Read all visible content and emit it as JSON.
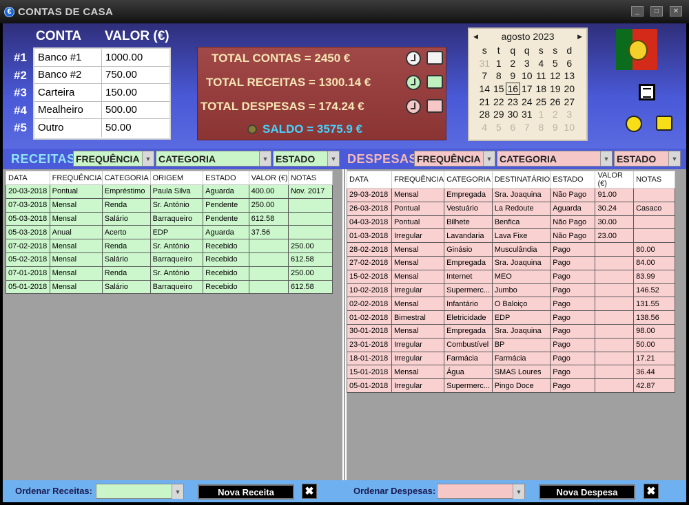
{
  "window": {
    "title": "CONTAS DE CASA",
    "app_icon": "€",
    "min": "_",
    "max": "□",
    "close": "✕"
  },
  "accounts": {
    "header_conta": "CONTA",
    "header_valor": "VALOR (€)",
    "rows": [
      {
        "num": "#1",
        "name": "Banco #1",
        "value": "1000.00"
      },
      {
        "num": "#2",
        "name": "Banco #2",
        "value": "750.00"
      },
      {
        "num": "#3",
        "name": "Carteira",
        "value": "150.00"
      },
      {
        "num": "#4",
        "name": "Mealheiro",
        "value": "500.00"
      },
      {
        "num": "#5",
        "name": "Outro",
        "value": "50.00"
      }
    ]
  },
  "totals": {
    "contas": "TOTAL CONTAS = 2450 €",
    "receitas": "TOTAL RECEITAS = 1300.14 €",
    "despesas": "TOTAL DESPESAS = 174.24 €",
    "saldo": "SALDO = 3575.9 €"
  },
  "calendar": {
    "month": "agosto 2023",
    "prev": "◀",
    "next": "▶",
    "weekdays": [
      "s",
      "t",
      "q",
      "q",
      "s",
      "s",
      "d"
    ],
    "days": [
      {
        "d": "31",
        "o": true
      },
      {
        "d": "1"
      },
      {
        "d": "2"
      },
      {
        "d": "3"
      },
      {
        "d": "4"
      },
      {
        "d": "5"
      },
      {
        "d": "6"
      },
      {
        "d": "7"
      },
      {
        "d": "8"
      },
      {
        "d": "9"
      },
      {
        "d": "10"
      },
      {
        "d": "11"
      },
      {
        "d": "12"
      },
      {
        "d": "13"
      },
      {
        "d": "14"
      },
      {
        "d": "15"
      },
      {
        "d": "16",
        "t": true
      },
      {
        "d": "17"
      },
      {
        "d": "18"
      },
      {
        "d": "19"
      },
      {
        "d": "20"
      },
      {
        "d": "21"
      },
      {
        "d": "22"
      },
      {
        "d": "23"
      },
      {
        "d": "24"
      },
      {
        "d": "25"
      },
      {
        "d": "26"
      },
      {
        "d": "27"
      },
      {
        "d": "28"
      },
      {
        "d": "29"
      },
      {
        "d": "30"
      },
      {
        "d": "31"
      },
      {
        "d": "1",
        "o": true
      },
      {
        "d": "2",
        "o": true
      },
      {
        "d": "3",
        "o": true
      },
      {
        "d": "4",
        "o": true
      },
      {
        "d": "5",
        "o": true
      },
      {
        "d": "6",
        "o": true
      },
      {
        "d": "7",
        "o": true
      },
      {
        "d": "8",
        "o": true
      },
      {
        "d": "9",
        "o": true
      },
      {
        "d": "10",
        "o": true
      }
    ]
  },
  "receitas": {
    "title": "RECEITAS",
    "filters": {
      "frequencia": "FREQUÊNCIA",
      "categoria": "CATEGORIA",
      "estado": "ESTADO"
    },
    "columns": [
      "DATA",
      "FREQUÊNCIA",
      "CATEGORIA",
      "ORIGEM",
      "ESTADO",
      "VALOR (€)",
      "NOTAS"
    ],
    "rows": [
      [
        "20-03-2018",
        "Pontual",
        "Empréstimo",
        "Paula Silva",
        "Aguarda",
        "400.00",
        "Nov. 2017"
      ],
      [
        "07-03-2018",
        "Mensal",
        "Renda",
        "Sr. António",
        "Pendente",
        "250.00",
        ""
      ],
      [
        "05-03-2018",
        "Mensal",
        "Salário",
        "Barraqueiro",
        "Pendente",
        "612.58",
        ""
      ],
      [
        "05-03-2018",
        "Anual",
        "Acerto",
        "EDP",
        "Aguarda",
        "37.56",
        ""
      ],
      [
        "07-02-2018",
        "Mensal",
        "Renda",
        "Sr. António",
        "Recebido",
        "",
        "250.00"
      ],
      [
        "05-02-2018",
        "Mensal",
        "Salário",
        "Barraqueiro",
        "Recebido",
        "",
        "612.58"
      ],
      [
        "07-01-2018",
        "Mensal",
        "Renda",
        "Sr. António",
        "Recebido",
        "",
        "250.00"
      ],
      [
        "05-01-2018",
        "Mensal",
        "Salário",
        "Barraqueiro",
        "Recebido",
        "",
        "612.58"
      ]
    ]
  },
  "despesas": {
    "title": "DESPESAS",
    "filters": {
      "frequencia": "FREQUÊNCIA",
      "categoria": "CATEGORIA",
      "estado": "ESTADO"
    },
    "columns": [
      "DATA",
      "FREQUÊNCIA",
      "CATEGORIA",
      "DESTINATÁRIO",
      "ESTADO",
      "VALOR (€)",
      "NOTAS"
    ],
    "rows": [
      [
        "29-03-2018",
        "Mensal",
        "Empregada",
        "Sra. Joaquina",
        "Não Pago",
        "91.00",
        ""
      ],
      [
        "26-03-2018",
        "Pontual",
        "Vestuário",
        "La Redoute",
        "Aguarda",
        "30.24",
        "Casaco"
      ],
      [
        "04-03-2018",
        "Pontual",
        "Bilhete",
        "Benfica",
        "Não Pago",
        "30.00",
        ""
      ],
      [
        "01-03-2018",
        "Irregular",
        "Lavandaria",
        "Lava Fixe",
        "Não Pago",
        "23.00",
        ""
      ],
      [
        "28-02-2018",
        "Mensal",
        "Ginásio",
        "Musculândia",
        "Pago",
        "",
        "80.00"
      ],
      [
        "27-02-2018",
        "Mensal",
        "Empregada",
        "Sra. Joaquina",
        "Pago",
        "",
        "84.00"
      ],
      [
        "15-02-2018",
        "Mensal",
        "Internet",
        "MEO",
        "Pago",
        "",
        "83.99"
      ],
      [
        "10-02-2018",
        "Irregular",
        "Supermerc...",
        "Jumbo",
        "Pago",
        "",
        "146.52"
      ],
      [
        "02-02-2018",
        "Mensal",
        "Infantário",
        "O Baloiço",
        "Pago",
        "",
        "131.55"
      ],
      [
        "01-02-2018",
        "Bimestral",
        "Eletricidade",
        "EDP",
        "Pago",
        "",
        "138.56"
      ],
      [
        "30-01-2018",
        "Mensal",
        "Empregada",
        "Sra. Joaquina",
        "Pago",
        "",
        "98.00"
      ],
      [
        "23-01-2018",
        "Irregular",
        "Combustível",
        "BP",
        "Pago",
        "",
        "50.00"
      ],
      [
        "18-01-2018",
        "Irregular",
        "Farmácia",
        "Farmácia",
        "Pago",
        "",
        "17.21"
      ],
      [
        "15-01-2018",
        "Mensal",
        "Água",
        "SMAS Loures",
        "Pago",
        "",
        "36.44"
      ],
      [
        "05-01-2018",
        "Irregular",
        "Supermerc...",
        "Pingo Doce",
        "Pago",
        "",
        "42.87"
      ]
    ]
  },
  "bottom": {
    "ordenar_receitas": "Ordenar Receitas:",
    "nova_receita": "Nova Receita",
    "ordenar_despesas": "Ordenar Despesas:",
    "nova_despesa": "Nova Despesa",
    "close_x": "✖",
    "dropdown_arrow": "▼"
  },
  "colors": {
    "receitas_title": "#8fe3ff",
    "despesas_title": "#f6b9b9"
  }
}
